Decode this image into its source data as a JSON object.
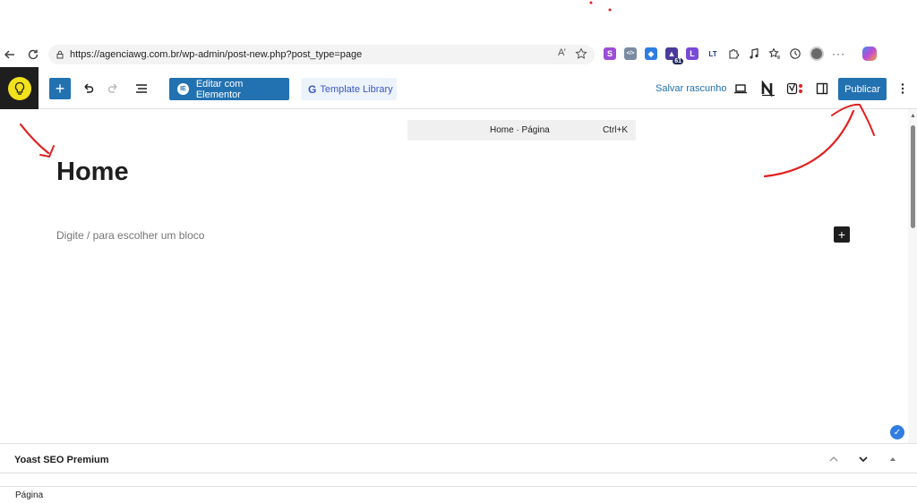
{
  "browser": {
    "url": "https://agenciawg.com.br/wp-admin/post-new.php?post_type=page",
    "read_aloud": "A’",
    "extensions": [
      {
        "name": "s-icon",
        "label": "S",
        "color": "#9b4fd8"
      },
      {
        "name": "code-icon",
        "label": "</>",
        "color": "#7a8aa0"
      },
      {
        "name": "tag-icon",
        "label": "◆",
        "color": "#2f7de1"
      },
      {
        "name": "hat-icon",
        "label": "▲",
        "color": "#4a3a9a",
        "badge": "61"
      },
      {
        "name": "l-icon",
        "label": "L",
        "color": "#7a4ad6"
      },
      {
        "name": "lt-icon",
        "label": "LT",
        "color": "#1e3a8a"
      }
    ]
  },
  "editor": {
    "elementor_label": "Editar com Elementor",
    "template_label": "Template Library",
    "save_draft_label": "Salvar rascunho",
    "publish_label": "Publicar",
    "doc_title": "Home · Página",
    "doc_shortcut": "Ctrl+K",
    "page_title": "Home",
    "block_placeholder": "Digite / para escolher um bloco"
  },
  "metabox": {
    "title": "Yoast SEO Premium"
  },
  "footer": {
    "breadcrumb": "Página"
  },
  "colors": {
    "wp_blue": "#2271b1",
    "logo_yellow": "#f2e21c",
    "annotation_red": "#e0201e"
  }
}
